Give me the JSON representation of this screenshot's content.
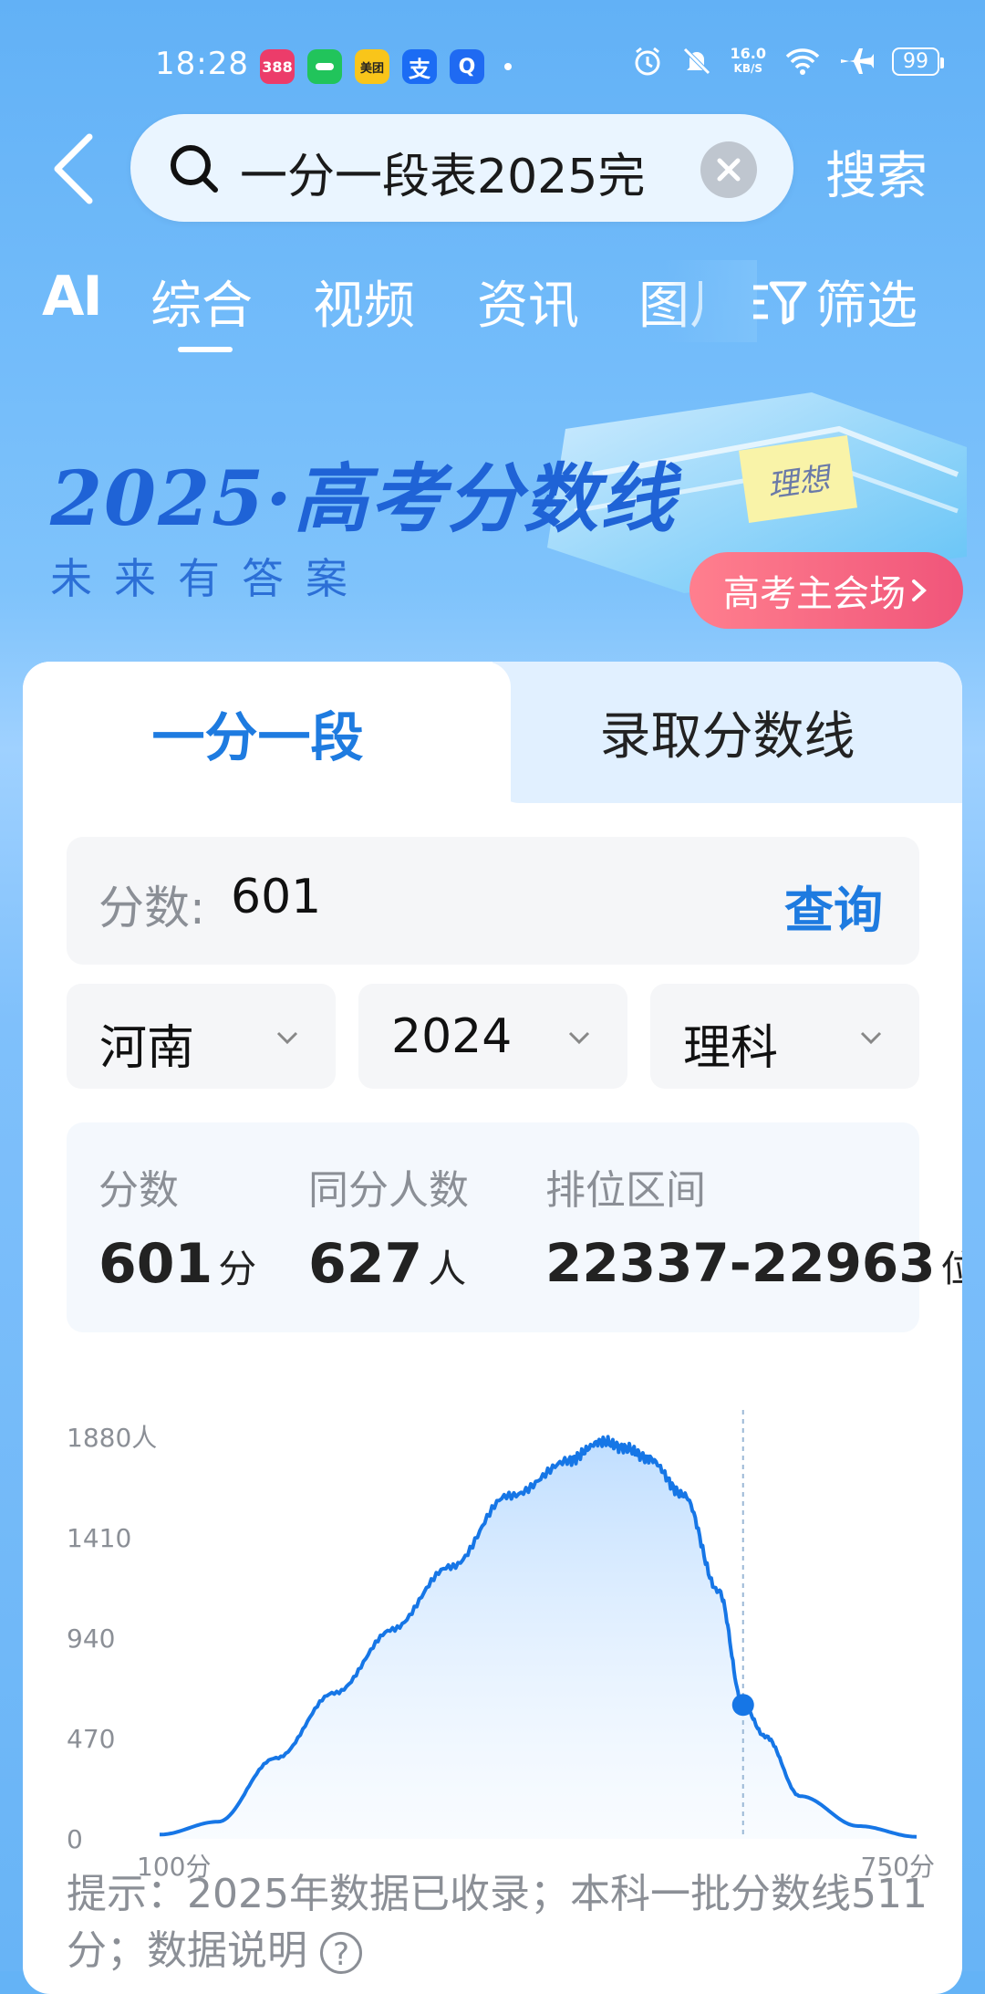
{
  "status_bar": {
    "time": "18:28",
    "apps": [
      {
        "icon": "app-388-icon",
        "label": "388",
        "color": "#ec3c6a"
      },
      {
        "icon": "wechat-pay-icon",
        "label": "",
        "color": "#21c45b"
      },
      {
        "icon": "meituan-icon",
        "label": "美团",
        "color": "#f9c51a"
      },
      {
        "icon": "alipay-icon",
        "label": "支",
        "color": "#1b6cf4"
      },
      {
        "icon": "app-q-icon",
        "label": "Q",
        "color": "#1f6af2"
      }
    ],
    "net_speed_value": "16.0",
    "net_speed_unit": "KB/S",
    "battery": "99"
  },
  "search": {
    "query": "一分一段表2025完",
    "button": "搜索"
  },
  "tabs": {
    "ai": "AI",
    "items": [
      "综合",
      "视频",
      "资讯",
      "图片"
    ],
    "active": "综合",
    "filter": "筛选"
  },
  "banner": {
    "title": "2025·高考分数线",
    "subtitle": "未来有答案",
    "sticky": "理想",
    "hub_button": "高考主会场"
  },
  "card": {
    "tabs": {
      "left": "一分一段",
      "right": "录取分数线"
    },
    "score_label": "分数:",
    "score_value": "601",
    "query_button": "查询",
    "dropdowns": {
      "province": "河南",
      "year": "2024",
      "subject": "理科"
    },
    "stats": {
      "score_header": "分数",
      "score_value": "601",
      "score_unit": "分",
      "count_header": "同分人数",
      "count_value": "627",
      "count_unit": "人",
      "rank_header": "排位区间",
      "rank_value": "22337-22963",
      "rank_unit": "位"
    },
    "tip": "提示：2025年数据已收录；本科一批分数线511分；数据说明"
  },
  "chart_data": {
    "type": "area",
    "y_unit": "人",
    "yticks": [
      "1880人",
      "1410",
      "940",
      "470",
      "0"
    ],
    "ytick_values": [
      1880,
      1410,
      940,
      470,
      0
    ],
    "xlim": [
      100,
      750
    ],
    "ylim": [
      0,
      1880
    ],
    "x_labels": [
      "100分",
      "750分"
    ],
    "marker": {
      "x": 601,
      "y": 627
    },
    "x": [
      100,
      150,
      200,
      250,
      300,
      350,
      400,
      450,
      480,
      500,
      520,
      550,
      580,
      601,
      620,
      650,
      700,
      750
    ],
    "values": [
      20,
      80,
      380,
      680,
      980,
      1280,
      1600,
      1770,
      1860,
      1830,
      1780,
      1610,
      1160,
      627,
      480,
      200,
      60,
      10
    ],
    "line_color": "#1676e6",
    "fill_color": "#cfe5ff"
  }
}
